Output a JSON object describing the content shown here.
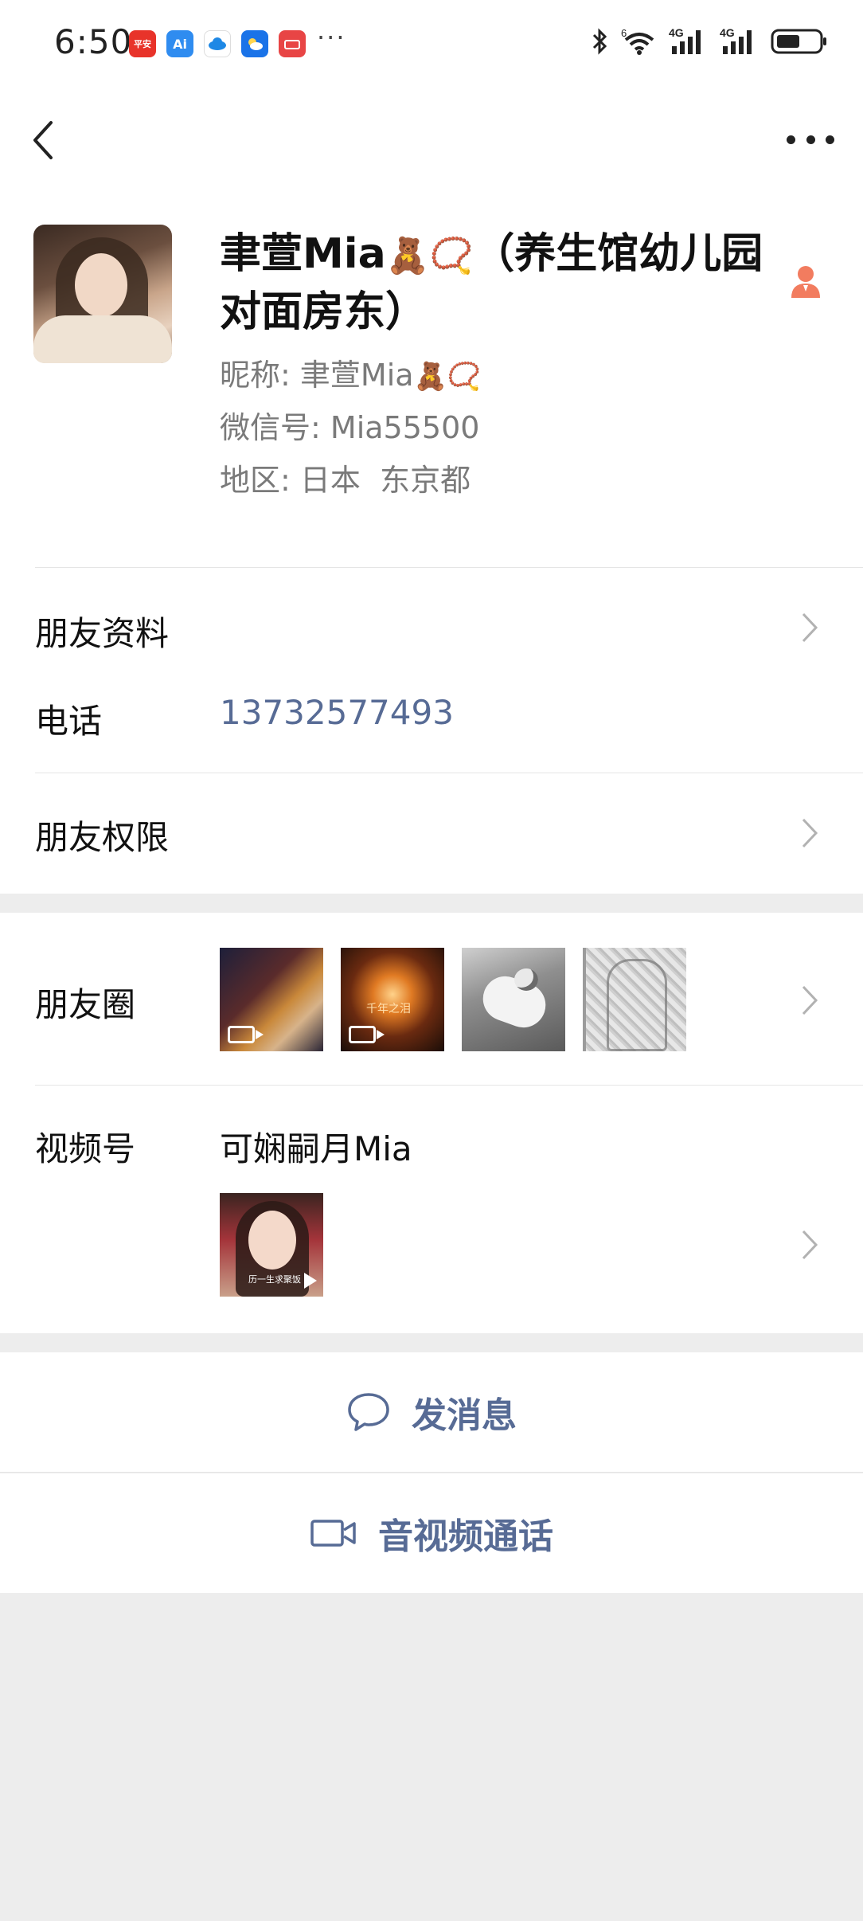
{
  "status_bar": {
    "time": "6:50",
    "apps": [
      {
        "name": "pingan-bank-app-icon",
        "color": "#e8332a",
        "text": "平安"
      },
      {
        "name": "ai-app-icon",
        "color": "#2f8cf0",
        "text": "Ai"
      },
      {
        "name": "cloud-app-icon",
        "color": "#1e88e5",
        "text": ""
      },
      {
        "name": "weather-app-icon",
        "color": "#1a73e8",
        "text": ""
      },
      {
        "name": "huawei-app-icon",
        "color": "#e84545",
        "text": ""
      }
    ],
    "more": "···",
    "signal_1": "4G",
    "signal_2": "4G",
    "wifi_badge": "6"
  },
  "profile": {
    "display_name": "聿萱Mia",
    "display_name_suffix": "（养生馆幼儿园对面房东）",
    "name_emoji": "🧸📿",
    "nickname_label": "昵称:",
    "nickname_value": "聿萱Mia",
    "nickname_emoji": "🧸📿",
    "wechat_id_label": "微信号:",
    "wechat_id_value": "Mia55500",
    "region_label": "地区:",
    "region_value": "日本  东京都"
  },
  "rows": {
    "friend_profile": "朋友资料",
    "phone_label": "电话",
    "phone_value": "13732577493",
    "friend_permissions": "朋友权限",
    "moments_label": "朋友圈",
    "moment_2_caption": "千年之泪",
    "channels_label": "视频号",
    "channels_name": "可娴嗣月Mia",
    "channels_video_caption": "历一生求聚饭"
  },
  "actions": {
    "send_message": "发消息",
    "av_call": "音视频通话"
  },
  "colors": {
    "link": "#576b95",
    "official_icon": "#f27c5f"
  }
}
